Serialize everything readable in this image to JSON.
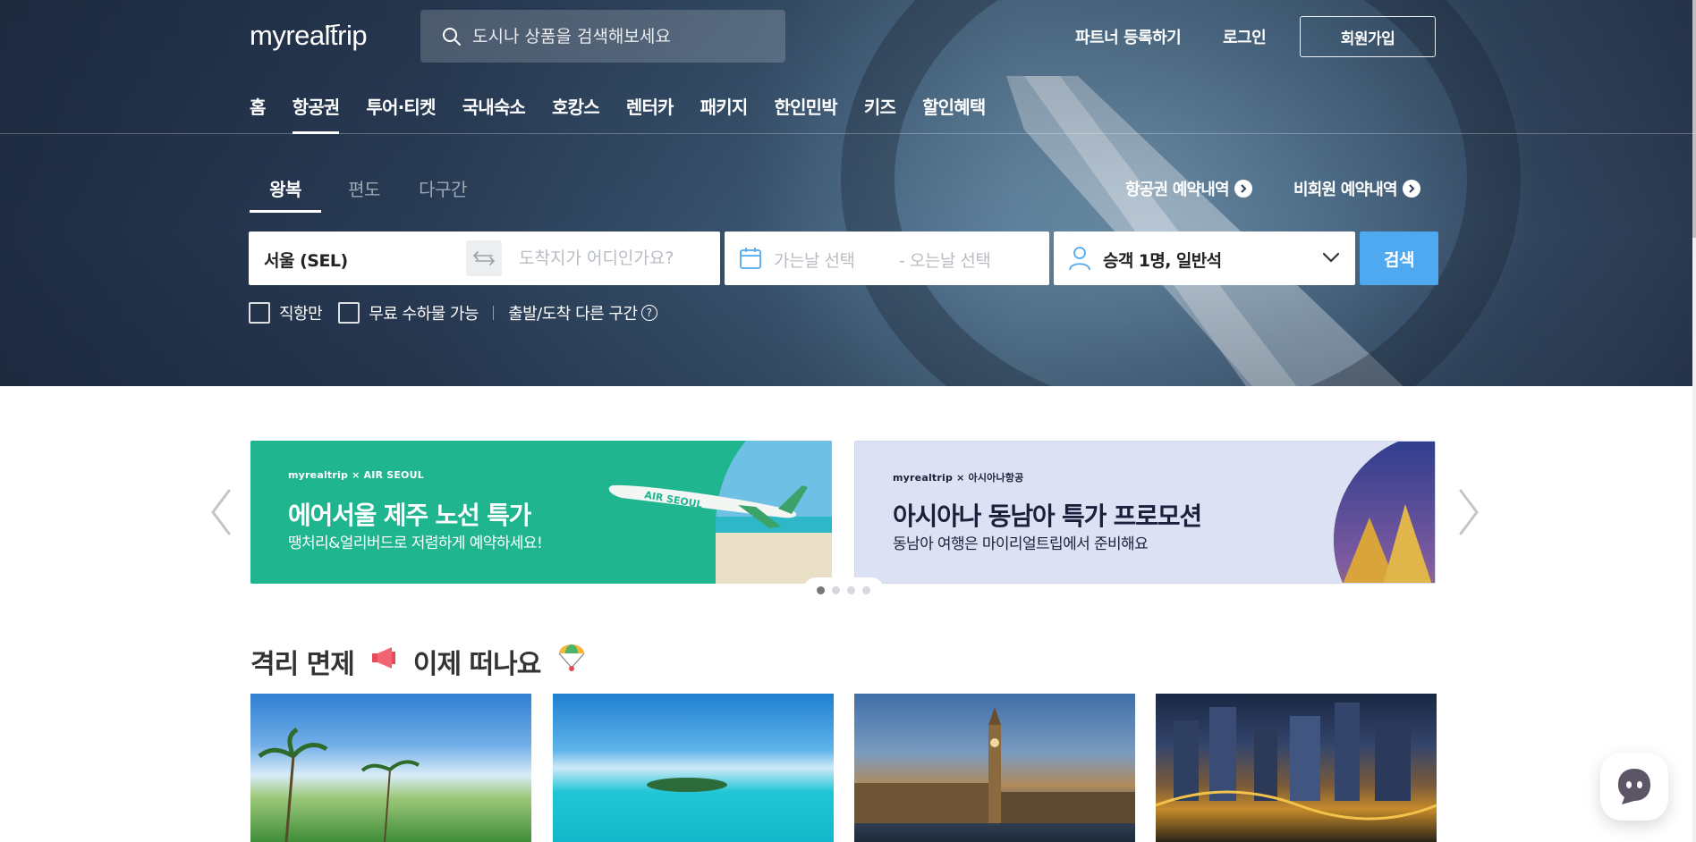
{
  "brand": {
    "logo_text": "myrealtrip"
  },
  "header": {
    "search_placeholder": "도시나 상품을 검색해보세요",
    "partner_link": "파트너 등록하기",
    "login_link": "로그인",
    "signup_button": "회원가입"
  },
  "nav": {
    "items": [
      {
        "label": "홈"
      },
      {
        "label": "항공권",
        "active": true
      },
      {
        "label": "투어·티켓"
      },
      {
        "label": "국내숙소"
      },
      {
        "label": "호캉스"
      },
      {
        "label": "렌터카"
      },
      {
        "label": "패키지"
      },
      {
        "label": "한인민박"
      },
      {
        "label": "키즈"
      },
      {
        "label": "할인혜택"
      }
    ]
  },
  "flight": {
    "trip_tabs": [
      {
        "label": "왕복",
        "active": true
      },
      {
        "label": "편도"
      },
      {
        "label": "다구간"
      }
    ],
    "reservation_link": "항공권 예약내역",
    "guest_reservation_link": "비회원 예약내역",
    "origin_value": "서울 (SEL)",
    "destination_placeholder": "도착지가 어디인가요?",
    "depart_placeholder": "가는날 선택",
    "return_placeholder": "- 오는날 선택",
    "passenger_value": "승객 1명, 일반석",
    "search_button": "검색",
    "options": {
      "direct_only": "직항만",
      "free_baggage": "무료 수하물 가능",
      "open_jaw": "출발/도착 다른 구간",
      "help_glyph": "?"
    }
  },
  "banners": [
    {
      "brand": "myrealtrip × AIR SEOUL",
      "title": "에어서울 제주 노선 특가",
      "subtitle": "땡처리&얼리버드로 저렴하게 예약하세요!",
      "plane_text": "AIR SEOUL"
    },
    {
      "brand": "myrealtrip × 아시아나항공",
      "title": "아시아나 동남아 특가 프로모션",
      "subtitle": "동남아 여행은 마이리얼트립에서 준비해요"
    }
  ],
  "carousel": {
    "dot_count": 4,
    "active_index": 0
  },
  "section": {
    "title_part1": "격리 면제",
    "title_part2": "이제 떠나요",
    "icons": [
      "megaphone-icon",
      "parachute-icon"
    ]
  },
  "cards": [
    {
      "scene": "tropical-beach"
    },
    {
      "scene": "island-sea"
    },
    {
      "scene": "london-big-ben"
    },
    {
      "scene": "city-night-river"
    }
  ],
  "colors": {
    "accent_blue": "#4fa9f0",
    "air_seoul_green": "#1fb58f",
    "asiana_bg": "#dce2f3",
    "hero_dark": "#2a3d57"
  }
}
